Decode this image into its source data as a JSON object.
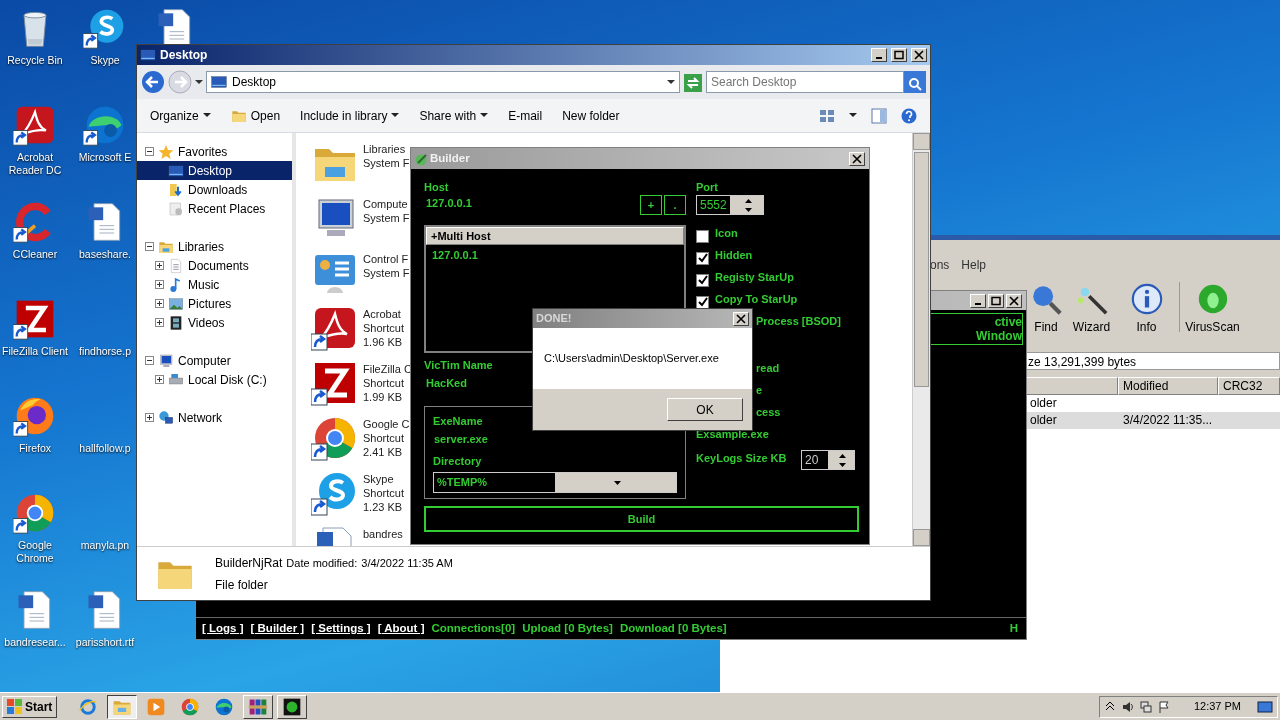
{
  "desktop": {
    "icons": [
      {
        "kind": "bin",
        "label": "Recycle Bin",
        "shortcut": false
      },
      {
        "kind": "acrobat",
        "label": "Acrobat Reader DC",
        "shortcut": true
      },
      {
        "kind": "ccleaner",
        "label": "CCleaner",
        "shortcut": true
      },
      {
        "kind": "filezilla",
        "label": "FileZilla Client",
        "shortcut": true
      },
      {
        "kind": "firefox",
        "label": "Firefox",
        "shortcut": true
      },
      {
        "kind": "chrome",
        "label": "Google Chrome",
        "shortcut": true
      },
      {
        "kind": "word",
        "label": "bandresear...",
        "shortcut": false
      },
      {
        "kind": "skype",
        "label": "Skype",
        "shortcut": true
      },
      {
        "kind": "edge",
        "label": "Microsoft E",
        "shortcut": true
      },
      {
        "kind": "word",
        "label": "baseshare.",
        "shortcut": false
      },
      {
        "kind": "blank",
        "label": "findhorse.p"
      },
      {
        "kind": "blank",
        "label": "hallfollow.p"
      },
      {
        "kind": "blank",
        "label": "manyla.pn"
      },
      {
        "kind": "word",
        "label": "parisshort.rtf",
        "shortcut": false
      },
      {
        "kind": "word",
        "shortcut": false
      }
    ]
  },
  "winrar": {
    "menu": [
      "ons",
      "Help"
    ],
    "tools": [
      {
        "kind": "find",
        "label": "Find"
      },
      {
        "kind": "wizard",
        "label": "Wizard"
      },
      {
        "kind": "info",
        "label": "Info"
      },
      {
        "kind": "virus",
        "label": "VirusScan"
      }
    ],
    "info": "ze 13,291,399 bytes",
    "columns": [
      "Modified",
      "CRC32"
    ],
    "rows": [
      {
        "type": "older",
        "selected": false
      },
      {
        "type": "older",
        "modified": "3/4/2022 11:35...",
        "selected": true
      }
    ]
  },
  "njrat": {
    "active_box": [
      "ctive",
      "Window"
    ],
    "status": [
      {
        "kind": "link",
        "label": "[ Logs ]"
      },
      {
        "kind": "link",
        "label": "[ Builder ]"
      },
      {
        "kind": "link",
        "label": "[ Settings ]"
      },
      {
        "kind": "link",
        "label": "[ About ]"
      },
      {
        "kind": "info",
        "label": "Connections[0]"
      },
      {
        "kind": "info",
        "label": "Upload [0 Bytes]"
      },
      {
        "kind": "info",
        "label": "Download [0 Bytes]"
      }
    ],
    "corner": "H"
  },
  "explorer": {
    "title": "Desktop",
    "address": "Desktop",
    "search": {
      "placeholder": "Search Desktop"
    },
    "toolbar": [
      {
        "kind": "plain",
        "label": "Organize",
        "dropdown": true
      },
      {
        "kind": "icon",
        "label": "Open",
        "dropdown": false
      },
      {
        "kind": "plain",
        "label": "Include in library",
        "dropdown": true
      },
      {
        "kind": "plain",
        "label": "Share with",
        "dropdown": true
      },
      {
        "kind": "plain",
        "label": "E-mail",
        "dropdown": false
      },
      {
        "kind": "plain",
        "label": "New folder",
        "dropdown": false
      }
    ],
    "tree": [
      {
        "kind": "star",
        "label": "Favorites",
        "expanded": true,
        "selected": false,
        "children": [
          {
            "kind": "desktop",
            "label": "Desktop",
            "selected": true
          },
          {
            "kind": "downloads",
            "label": "Downloads",
            "selected": false
          },
          {
            "kind": "recent",
            "label": "Recent Places",
            "selected": false
          }
        ]
      },
      {
        "kind": "libraries",
        "label": "Libraries",
        "expanded": true,
        "selected": false,
        "children": [
          {
            "kind": "documents",
            "label": "Documents",
            "expanded": false,
            "selected": false
          },
          {
            "kind": "music",
            "label": "Music",
            "expanded": false,
            "selected": false
          },
          {
            "kind": "pictures",
            "label": "Pictures",
            "expanded": false,
            "selected": false
          },
          {
            "kind": "videos",
            "label": "Videos",
            "expanded": false,
            "selected": false
          }
        ]
      },
      {
        "kind": "computer",
        "label": "Computer",
        "expanded": true,
        "selected": false,
        "children": [
          {
            "kind": "disk",
            "label": "Local Disk (C:)",
            "expanded": false,
            "selected": false
          }
        ]
      },
      {
        "kind": "network",
        "label": "Network",
        "expanded": false,
        "selected": false
      }
    ],
    "items": [
      {
        "kind": "libraries",
        "shortcut": false,
        "lines": [
          "Libraries",
          "System F"
        ]
      },
      {
        "kind": "computer",
        "shortcut": false,
        "lines": [
          "Compute",
          "System F"
        ]
      },
      {
        "kind": "controlpanel",
        "shortcut": false,
        "lines": [
          "Control F",
          "System F"
        ]
      },
      {
        "kind": "acrobat",
        "shortcut": true,
        "lines": [
          "Acrobat",
          "Shortcut",
          "1.96 KB"
        ]
      },
      {
        "kind": "filezilla",
        "shortcut": true,
        "lines": [
          "FileZilla C",
          "Shortcut",
          "1.99 KB"
        ]
      },
      {
        "kind": "chrome",
        "shortcut": true,
        "lines": [
          "Google C",
          "Shortcut",
          "2.41 KB"
        ]
      },
      {
        "kind": "skype",
        "shortcut": true,
        "lines": [
          "Skype",
          "Shortcut",
          "1.23 KB"
        ]
      },
      {
        "kind": "word",
        "lines": [
          "bandres"
        ]
      }
    ],
    "details": {
      "name": "BuilderNjRat",
      "date_label": "Date modified:",
      "date": "3/4/2022 11:35 AM",
      "type": "File folder"
    }
  },
  "builder": {
    "title": "Builder",
    "host_label": "Host",
    "host": "127.0.0.1",
    "host_buttons": [
      "+",
      "."
    ],
    "list_header": "+Multi Host",
    "hosts": [
      "127.0.0.1"
    ],
    "victim_label": "VicTim Name",
    "victim": "HacKed",
    "exe_label": "ExeName",
    "exe": "server.exe",
    "dir_label": "Directory",
    "dir": "%TEMP%",
    "port_label": "Port",
    "port": "5552",
    "options": [
      {
        "kind": "check",
        "label": "Icon",
        "checked": false
      },
      {
        "kind": "check",
        "label": "Hidden",
        "checked": true
      },
      {
        "kind": "check",
        "label": "Registy StarUp",
        "checked": true
      },
      {
        "kind": "check",
        "label": "Copy To StarUp",
        "checked": true
      },
      {
        "kind": "covered",
        "label": "Process [BSOD]"
      },
      {
        "kind": "covered",
        "label": "read"
      },
      {
        "kind": "covered",
        "label": "e"
      },
      {
        "kind": "covered",
        "label": "cess"
      },
      {
        "kind": "value",
        "label": "Exsample.exe"
      }
    ],
    "keylogs_label": "KeyLogs Size KB",
    "keylogs": "20",
    "build": "Build"
  },
  "dialog": {
    "title": "DONE!",
    "message": "C:\\Users\\admin\\Desktop\\Server.exe",
    "ok": "OK"
  },
  "taskbar": {
    "start": "Start",
    "apps": [
      {
        "kind": "ie",
        "selected": false,
        "running": false
      },
      {
        "kind": "explorer",
        "selected": true,
        "running": true
      },
      {
        "kind": "media",
        "selected": false,
        "running": false
      },
      {
        "kind": "chrome",
        "selected": false,
        "running": false
      },
      {
        "kind": "edge",
        "selected": false,
        "running": false
      },
      {
        "kind": "winrar",
        "selected": false,
        "running": true
      },
      {
        "kind": "njrat",
        "selected": false,
        "running": true
      }
    ],
    "clock": "12:37 PM"
  }
}
